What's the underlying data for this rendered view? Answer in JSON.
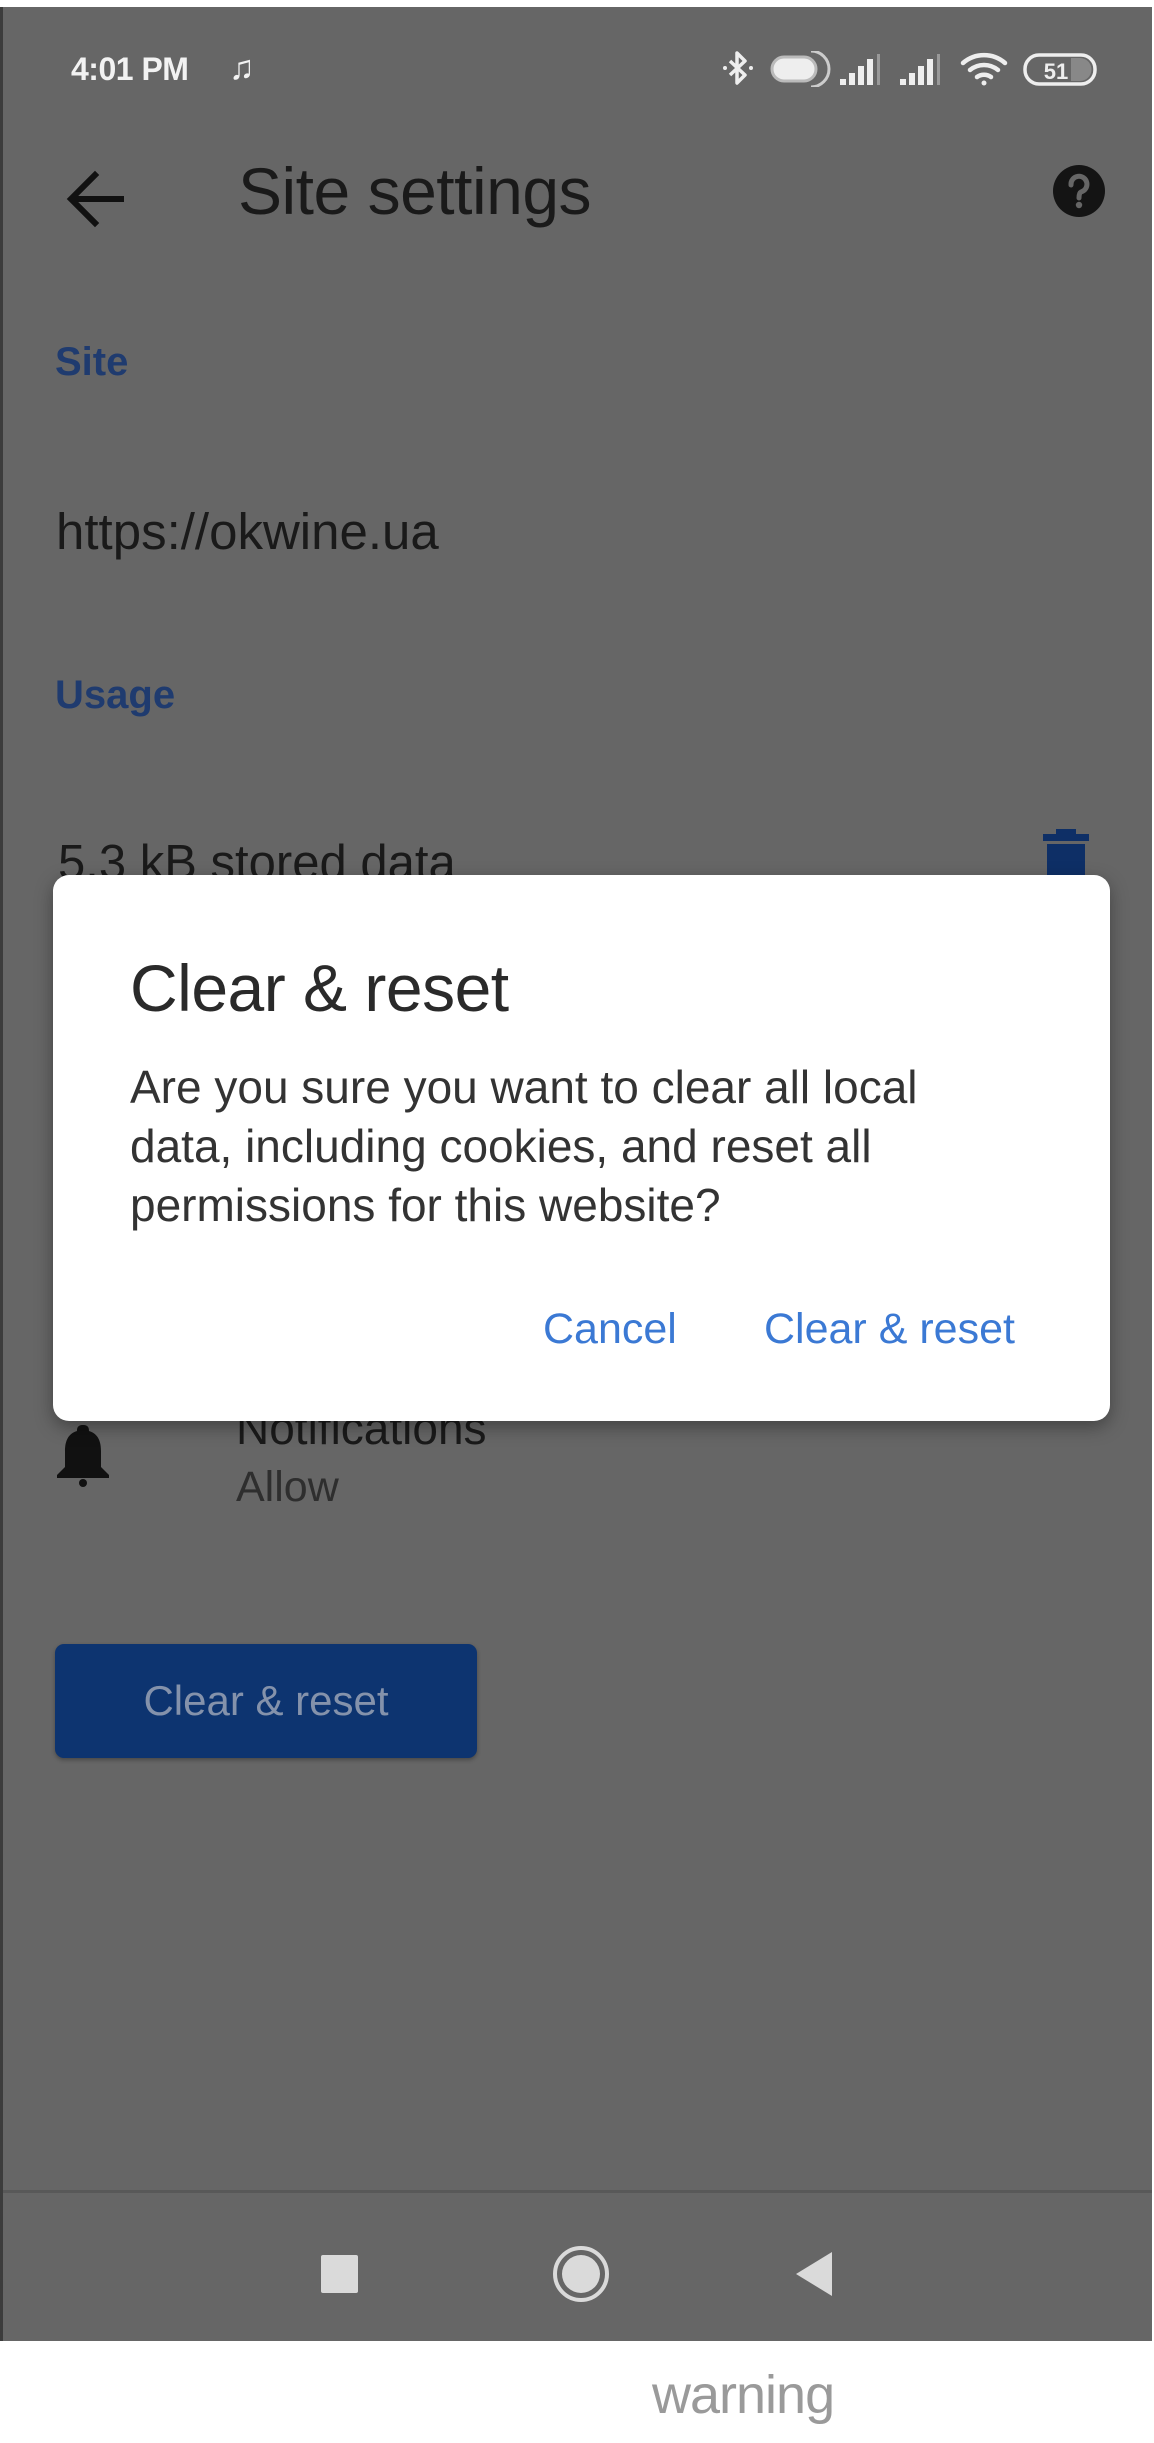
{
  "status_bar": {
    "time": "4:01 PM",
    "media_icon": "music-note-icon",
    "icons": [
      "bluetooth-icon",
      "headset-icon",
      "signal-icon",
      "signal-icon",
      "wifi-icon",
      "battery-icon"
    ],
    "battery_level": "51"
  },
  "app_bar": {
    "back_icon": "arrow-back-icon",
    "title": "Site settings",
    "help_icon": "help-icon"
  },
  "sections": {
    "site_label": "Site",
    "site_url": "https://okwine.ua",
    "usage_label": "Usage",
    "stored_data": "5.3 kB stored data",
    "trash_icon": "trash-icon"
  },
  "permissions": [
    {
      "icon": "bell-icon",
      "title": "Notifications",
      "value": "Allow"
    }
  ],
  "clear_reset_button": "Clear & reset",
  "dialog": {
    "title": "Clear & reset",
    "message_lines": [
      "Are you sure you want to clear all local",
      "data, including cookies, and reset all",
      "permissions for this website?"
    ],
    "cancel": "Cancel",
    "confirm": "Clear & reset"
  },
  "nav_bar": {
    "recents": "recents-icon",
    "home": "home-icon",
    "back": "back-triangle-icon"
  },
  "caption": "warning",
  "colors": {
    "scrim_background": "#666666",
    "accent_blue": "#3b79d4",
    "section_label": "#1f3b6f",
    "primary_button": "#0d3470"
  }
}
